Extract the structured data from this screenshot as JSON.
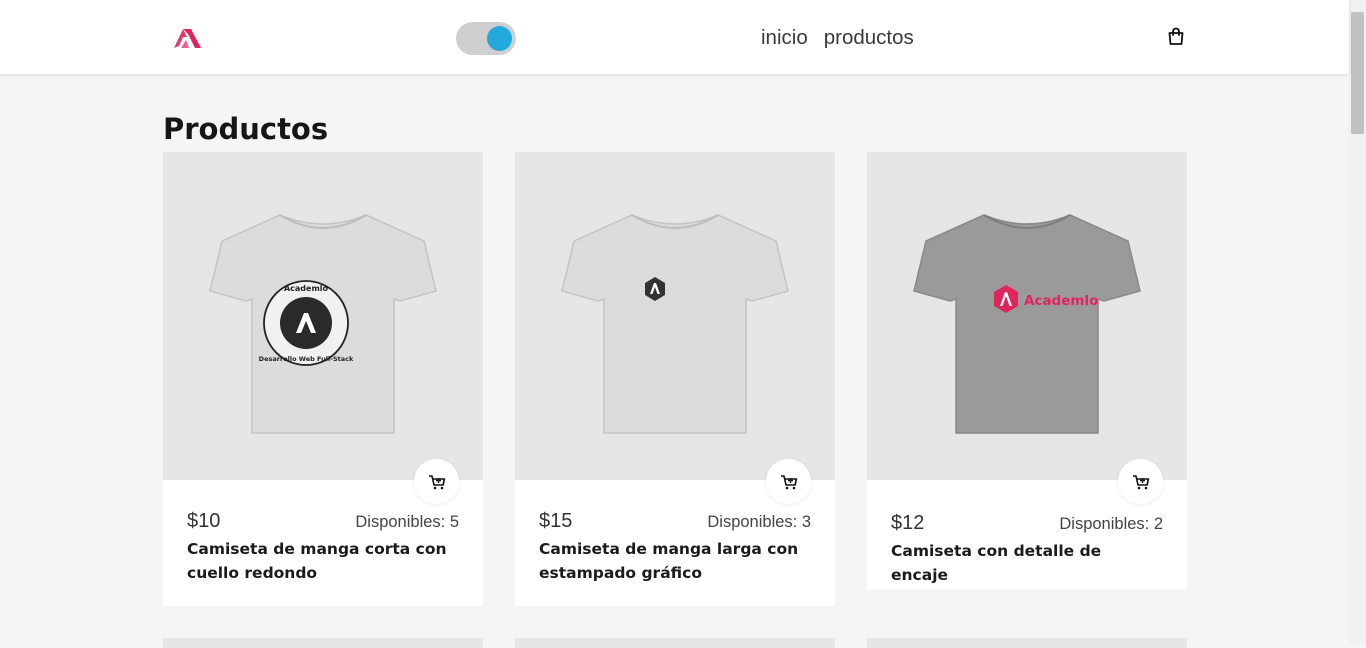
{
  "header": {
    "logo_icon": "academlo-logo-icon",
    "theme_toggle": {
      "state": "on",
      "knob_color": "#24a9dc"
    },
    "nav": [
      {
        "label": "inicio"
      },
      {
        "label": "productos"
      }
    ],
    "cart_icon": "shopping-bag-icon"
  },
  "page": {
    "title": "Productos"
  },
  "products": [
    {
      "price": "$10",
      "stock": "Disponibles: 5",
      "name": "Camiseta de manga corta con cuello redondo",
      "shirt_color": "#dcdcdc",
      "design": "circular-badge"
    },
    {
      "price": "$15",
      "stock": "Disponibles: 3",
      "name": "Camiseta de manga larga con estampado gráfico",
      "shirt_color": "#dcdcdc",
      "design": "small-hexagon-logo"
    },
    {
      "price": "$12",
      "stock": "Disponibles: 2",
      "name": "Camiseta con detalle de encaje",
      "shirt_color": "#9a9a9a",
      "design": "academlo-wordmark"
    }
  ],
  "colors": {
    "accent": "#24a9dc",
    "brand": "#e0245e",
    "background": "#f5f5f5"
  }
}
